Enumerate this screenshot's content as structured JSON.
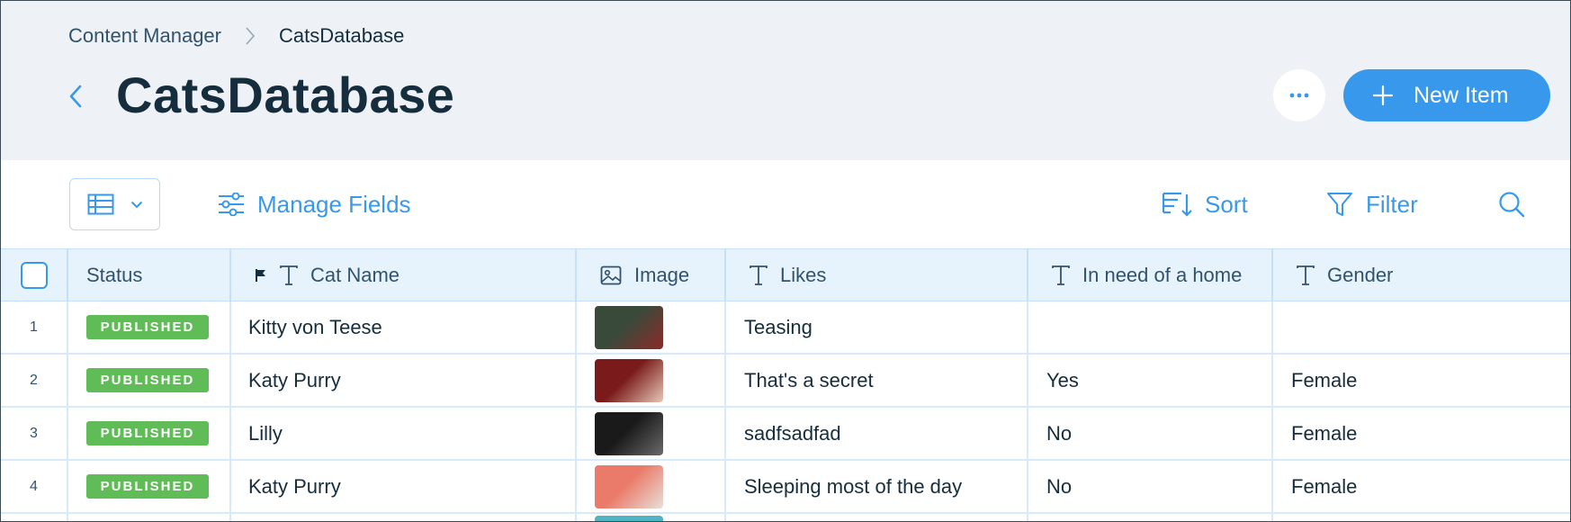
{
  "breadcrumb": {
    "root": "Content Manager",
    "current": "CatsDatabase"
  },
  "header": {
    "title": "CatsDatabase",
    "new_item_label": "New Item",
    "more_icon": "ellipsis-icon"
  },
  "toolbar": {
    "manage_fields": "Manage Fields",
    "sort": "Sort",
    "filter": "Filter"
  },
  "table": {
    "columns": {
      "status": "Status",
      "cat_name": "Cat Name",
      "image": "Image",
      "likes": "Likes",
      "in_need": "In need of a home",
      "gender": "Gender"
    },
    "rows": [
      {
        "num": "1",
        "status": "PUBLISHED",
        "name": "Kitty von Teese",
        "likes": "Teasing",
        "in_need": "",
        "gender": "",
        "thumb_colors": [
          "#3a4a3a",
          "#8a2a2a"
        ]
      },
      {
        "num": "2",
        "status": "PUBLISHED",
        "name": "Katy Purry",
        "likes": "That's a secret",
        "in_need": "Yes",
        "gender": "Female",
        "thumb_colors": [
          "#7a1a1a",
          "#e8c8b8"
        ]
      },
      {
        "num": "3",
        "status": "PUBLISHED",
        "name": "Lilly",
        "likes": "sadfsadfad",
        "in_need": "No",
        "gender": "Female",
        "thumb_colors": [
          "#1a1a1a",
          "#6a6a6a"
        ]
      },
      {
        "num": "4",
        "status": "PUBLISHED",
        "name": "Katy Purry",
        "likes": "Sleeping most of the day",
        "in_need": "No",
        "gender": "Female",
        "thumb_colors": [
          "#ea7a6a",
          "#e8e0d8"
        ]
      }
    ]
  },
  "colors": {
    "accent": "#3899ec",
    "published": "#60bc57",
    "header_bg": "#eef2f6"
  }
}
